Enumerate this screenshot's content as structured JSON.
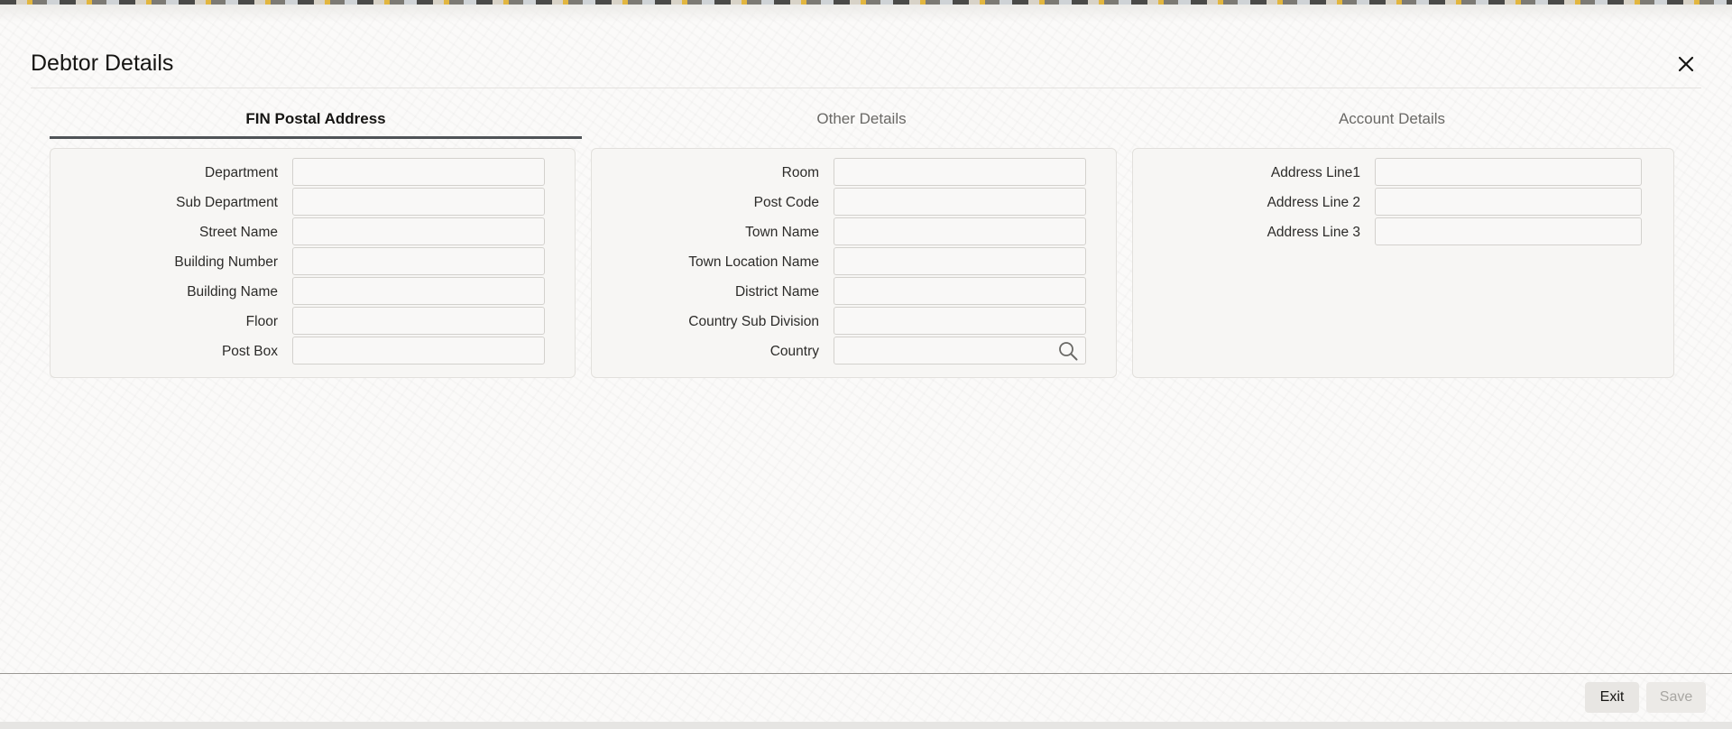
{
  "dialog": {
    "title": "Debtor Details"
  },
  "tabs": [
    {
      "label": "FIN Postal Address",
      "active": true
    },
    {
      "label": "Other Details",
      "active": false
    },
    {
      "label": "Account Details",
      "active": false
    }
  ],
  "panels": {
    "postal": {
      "fields": [
        {
          "label": "Department",
          "value": ""
        },
        {
          "label": "Sub Department",
          "value": ""
        },
        {
          "label": "Street Name",
          "value": ""
        },
        {
          "label": "Building Number",
          "value": ""
        },
        {
          "label": "Building Name",
          "value": ""
        },
        {
          "label": "Floor",
          "value": ""
        },
        {
          "label": "Post Box",
          "value": ""
        }
      ]
    },
    "other": {
      "fields": [
        {
          "label": "Room",
          "value": ""
        },
        {
          "label": "Post Code",
          "value": ""
        },
        {
          "label": "Town Name",
          "value": ""
        },
        {
          "label": "Town Location Name",
          "value": ""
        },
        {
          "label": "District Name",
          "value": ""
        },
        {
          "label": "Country Sub Division",
          "value": ""
        },
        {
          "label": "Country",
          "value": "",
          "icon": "search-icon"
        }
      ]
    },
    "account": {
      "fields": [
        {
          "label": "Address Line1",
          "value": ""
        },
        {
          "label": "Address Line 2",
          "value": ""
        },
        {
          "label": "Address Line 3",
          "value": ""
        }
      ]
    }
  },
  "footer": {
    "exit_label": "Exit",
    "save_label": "Save"
  },
  "icons": {
    "close": "close-icon",
    "search": "search-icon"
  },
  "colors": {
    "active_tab_underline": "#4f5357",
    "panel_background": "#f7f6f4",
    "disabled_text": "#a8a6a2"
  }
}
